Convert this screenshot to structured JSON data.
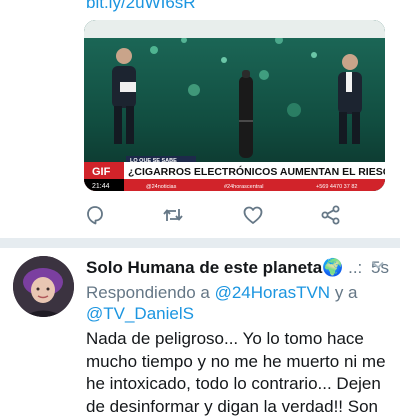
{
  "top_link": "bit.ly/2uWI6sR",
  "media": {
    "badge_caption": "LO QUE SE SABE",
    "headline": "¿CIGARROS ELECTRÓNICOS AUMENTAN EL RIESGO?",
    "gif_label": "GIF",
    "clock": "21:44",
    "ticker": [
      "@24noticias",
      "#24horascentral",
      "+569 4470 37 82"
    ]
  },
  "tweet": {
    "display_name": "Solo Humana de este planeta",
    "emoji": "🌍",
    "separator": "..:",
    "time": "5s",
    "replying_to_label": "Respondiendo a",
    "mention_1": "@24HorasTVN",
    "conjunction": "y a",
    "mention_2": "@TV_DanielS",
    "body_lines": [
      "Nada de peligroso... Yo lo tomo hace",
      "mucho tiempo y no me he muerto ni me",
      "he  intoxicado, todo lo contrario... Dejen",
      "de desinformar y digan la verdad!! Son"
    ]
  },
  "icons": [
    "reply-icon",
    "retweet-icon",
    "like-icon",
    "share-icon",
    "chevron-down-icon"
  ],
  "colors": {
    "link": "#1b95e0",
    "muted": "#657786",
    "text": "#14171a",
    "divider": "#e6ecf0"
  }
}
